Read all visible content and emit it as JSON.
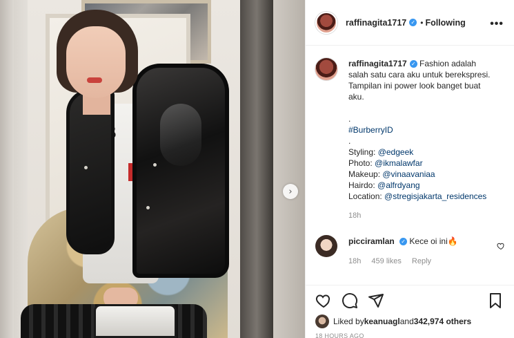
{
  "post": {
    "username": "raffinagita1717",
    "verified_mark": "✓",
    "dot": "•",
    "follow_status": "Following",
    "more_label": "•••",
    "next_arrow": "›"
  },
  "caption": {
    "username": "raffinagita1717",
    "text": "Fashion adalah salah satu cara aku untuk berekspresi. Tampilan ini power look banget buat aku.",
    "dot1": ".",
    "hashtag": "#BurberryID",
    "dot2": ".",
    "credits": [
      {
        "label": "Styling: ",
        "handle": "@edgeek"
      },
      {
        "label": "Photo: ",
        "handle": "@ikmalawfar"
      },
      {
        "label": "Makeup: ",
        "handle": "@vinaavaniaa"
      },
      {
        "label": "Hairdo: ",
        "handle": "@alfrdyang"
      },
      {
        "label": "Location: ",
        "handle": "@stregisjakarta_residences"
      }
    ],
    "time": "18h"
  },
  "comment": {
    "username": "picciramlan",
    "text": "Kece oi ini🔥",
    "time": "18h",
    "likes": "459 likes",
    "reply": "Reply"
  },
  "likes_line": {
    "prefix": "Liked by ",
    "user": "keanuagl",
    "middle": " and ",
    "count": "342,974 others"
  },
  "date": "18 HOURS AGO",
  "icons": {
    "like": "heart-icon",
    "comment": "comment-icon",
    "share": "send-icon",
    "save": "bookmark-icon"
  },
  "colors": {
    "link": "#00376b",
    "verified": "#3897f0",
    "muted": "#8e8e8e",
    "text": "#262626"
  }
}
